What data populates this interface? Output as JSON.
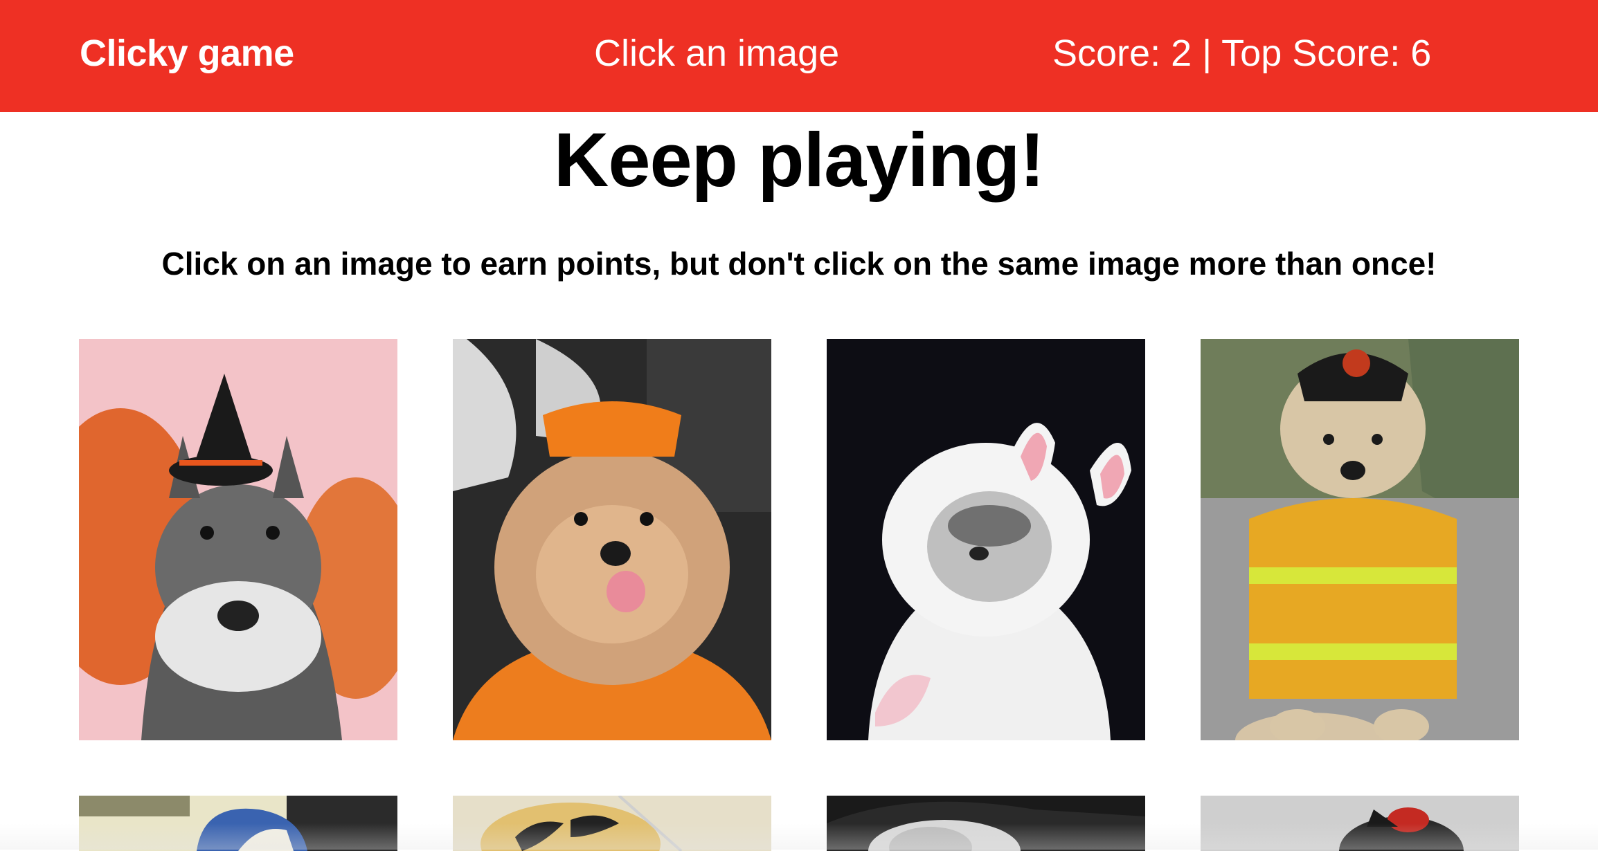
{
  "navbar": {
    "brand": "Clicky game",
    "status": "Click an image",
    "score": "Score: 2 | Top Score: 6",
    "color": "#ee3024"
  },
  "main": {
    "headline": "Keep playing!",
    "instructions": "Click on an image to earn points, but don't click on the same image more than once!"
  },
  "images": [
    {
      "name": "schnauzer-witch-hat"
    },
    {
      "name": "pomeranian-pumpkin-costume"
    },
    {
      "name": "cat-bunny-ears"
    },
    {
      "name": "doodle-firefighter"
    },
    {
      "name": "dog-blue-cap"
    },
    {
      "name": "dog-bumblebee"
    },
    {
      "name": "dog-black-hat"
    },
    {
      "name": "dog-red-hat"
    }
  ]
}
